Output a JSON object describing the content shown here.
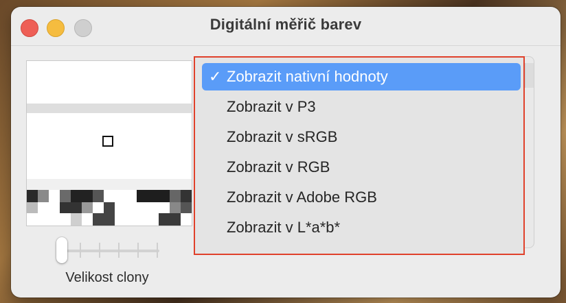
{
  "window": {
    "title": "Digitální měřič barev"
  },
  "menu": {
    "items": [
      {
        "label": "Zobrazit nativní hodnoty",
        "selected": true
      },
      {
        "label": "Zobrazit v P3",
        "selected": false
      },
      {
        "label": "Zobrazit v sRGB",
        "selected": false
      },
      {
        "label": "Zobrazit v RGB",
        "selected": false
      },
      {
        "label": "Zobrazit v Adobe RGB",
        "selected": false
      },
      {
        "label": "Zobrazit v L*a*b*",
        "selected": false
      }
    ],
    "check_glyph": "✓"
  },
  "slider": {
    "label": "Velikost clony",
    "value_fraction": 0.0
  },
  "colors": {
    "accent": "#5a9cf8",
    "highlight_border": "#e0402a",
    "close": "#ee5f56",
    "minimize": "#f5bc3f",
    "zoom": "#cfcfcf"
  }
}
